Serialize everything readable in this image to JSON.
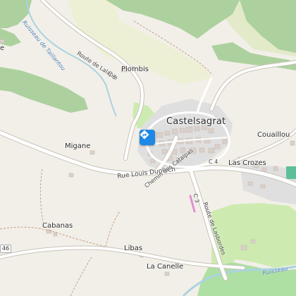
{
  "map": {
    "colors": {
      "background": "#f2efe9",
      "wood": "#add19e",
      "meadow": "#cdebb0",
      "scrub": "#e3eac9",
      "orchard": "#aedfa3",
      "residential": "#e0dfdf",
      "building": "#d9d0c9",
      "road_fill": "#ffffff",
      "road_casing": "#c9c3b8",
      "water": "#aad3df",
      "path": "#c4a27e",
      "poi": "#1e88e5",
      "sports": "#5cbf9a"
    },
    "place_labels": {
      "castelsagrat": "Castelsagrat",
      "plombis": "Plombis",
      "migane": "Migane",
      "las_crozes": "Las Crozes",
      "couaillou": "Couaillou",
      "cabanas": "Cabanas",
      "libas": "Libas",
      "la_canelle": "La Canelle",
      "edge_e": "e"
    },
    "road_labels": {
      "route_de_lalapie": "Route de Lalapie",
      "c6": "C 6",
      "rue_louis_duplech": "Rue Louis Duplech",
      "chemin_des_catalpas": "Chemin des Catalpas",
      "c4": "C 4",
      "c3": "C 3",
      "route_de_lasbordes": "Route de Lasbordes"
    },
    "water_labels": {
      "ruisseau_de_taillantou": "Ruisseau de Taillantou",
      "ruisseau_se": "Ruisseau"
    },
    "shields": {
      "d46": "46"
    },
    "poi_icon": "directions-diamond-icon"
  }
}
